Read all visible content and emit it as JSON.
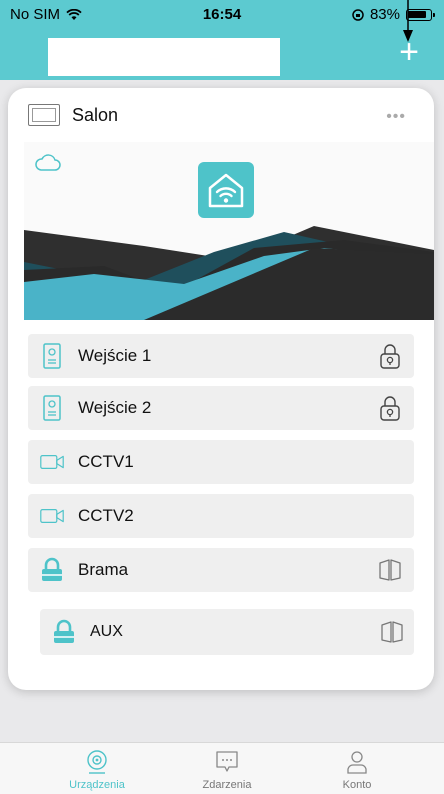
{
  "status_bar": {
    "carrier": "No SIM",
    "time": "16:54",
    "battery": "83%"
  },
  "nav": {
    "title": "",
    "add_label": "+"
  },
  "device": {
    "name": "Salon",
    "more_label": "•••",
    "accent_color": "#4ec3c9"
  },
  "rows": [
    {
      "label": "Wejście 1",
      "icon": "intercom-panel-icon",
      "action": "lock-icon"
    },
    {
      "label": "Wejście 2",
      "icon": "intercom-panel-icon",
      "action": "lock-icon"
    },
    {
      "label": "CCTV1",
      "icon": "camera-icon",
      "action": ""
    },
    {
      "label": "CCTV2",
      "icon": "camera-icon",
      "action": ""
    },
    {
      "label": "Brama",
      "icon": "padlock-icon",
      "action": "gate-icon"
    },
    {
      "label": "AUX",
      "icon": "padlock-icon",
      "action": "gate-icon"
    }
  ],
  "tabs": [
    {
      "label": "Urządzenia",
      "icon": "device-icon",
      "active": true
    },
    {
      "label": "Zdarzenia",
      "icon": "message-icon",
      "active": false
    },
    {
      "label": "Konto",
      "icon": "user-icon",
      "active": false
    }
  ]
}
